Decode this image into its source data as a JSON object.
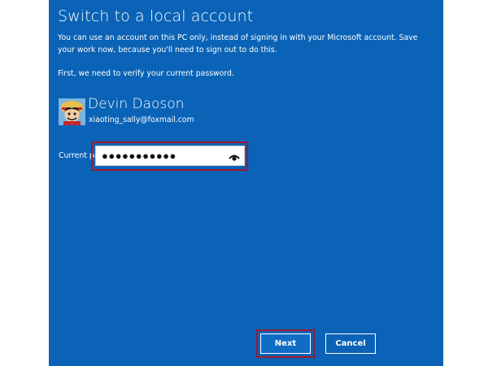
{
  "window": {
    "title": "Switch to a local account",
    "description": "You can use an account on this PC only, instead of signing in with your Microsoft account. Save your work now, because you'll need to sign out to do this.",
    "verify_text": "First, we need to verify your current password."
  },
  "user": {
    "name": "Devin Daoson",
    "email": "xiaoting_sally@foxmail.com",
    "avatar_icon": "user-avatar"
  },
  "password": {
    "label": "Current password",
    "value": "●●●●●●●●●●●",
    "reveal_icon": "eye-icon"
  },
  "buttons": {
    "next": "Next",
    "cancel": "Cancel"
  },
  "colors": {
    "background": "#0a63b6",
    "highlight": "#a01830"
  }
}
